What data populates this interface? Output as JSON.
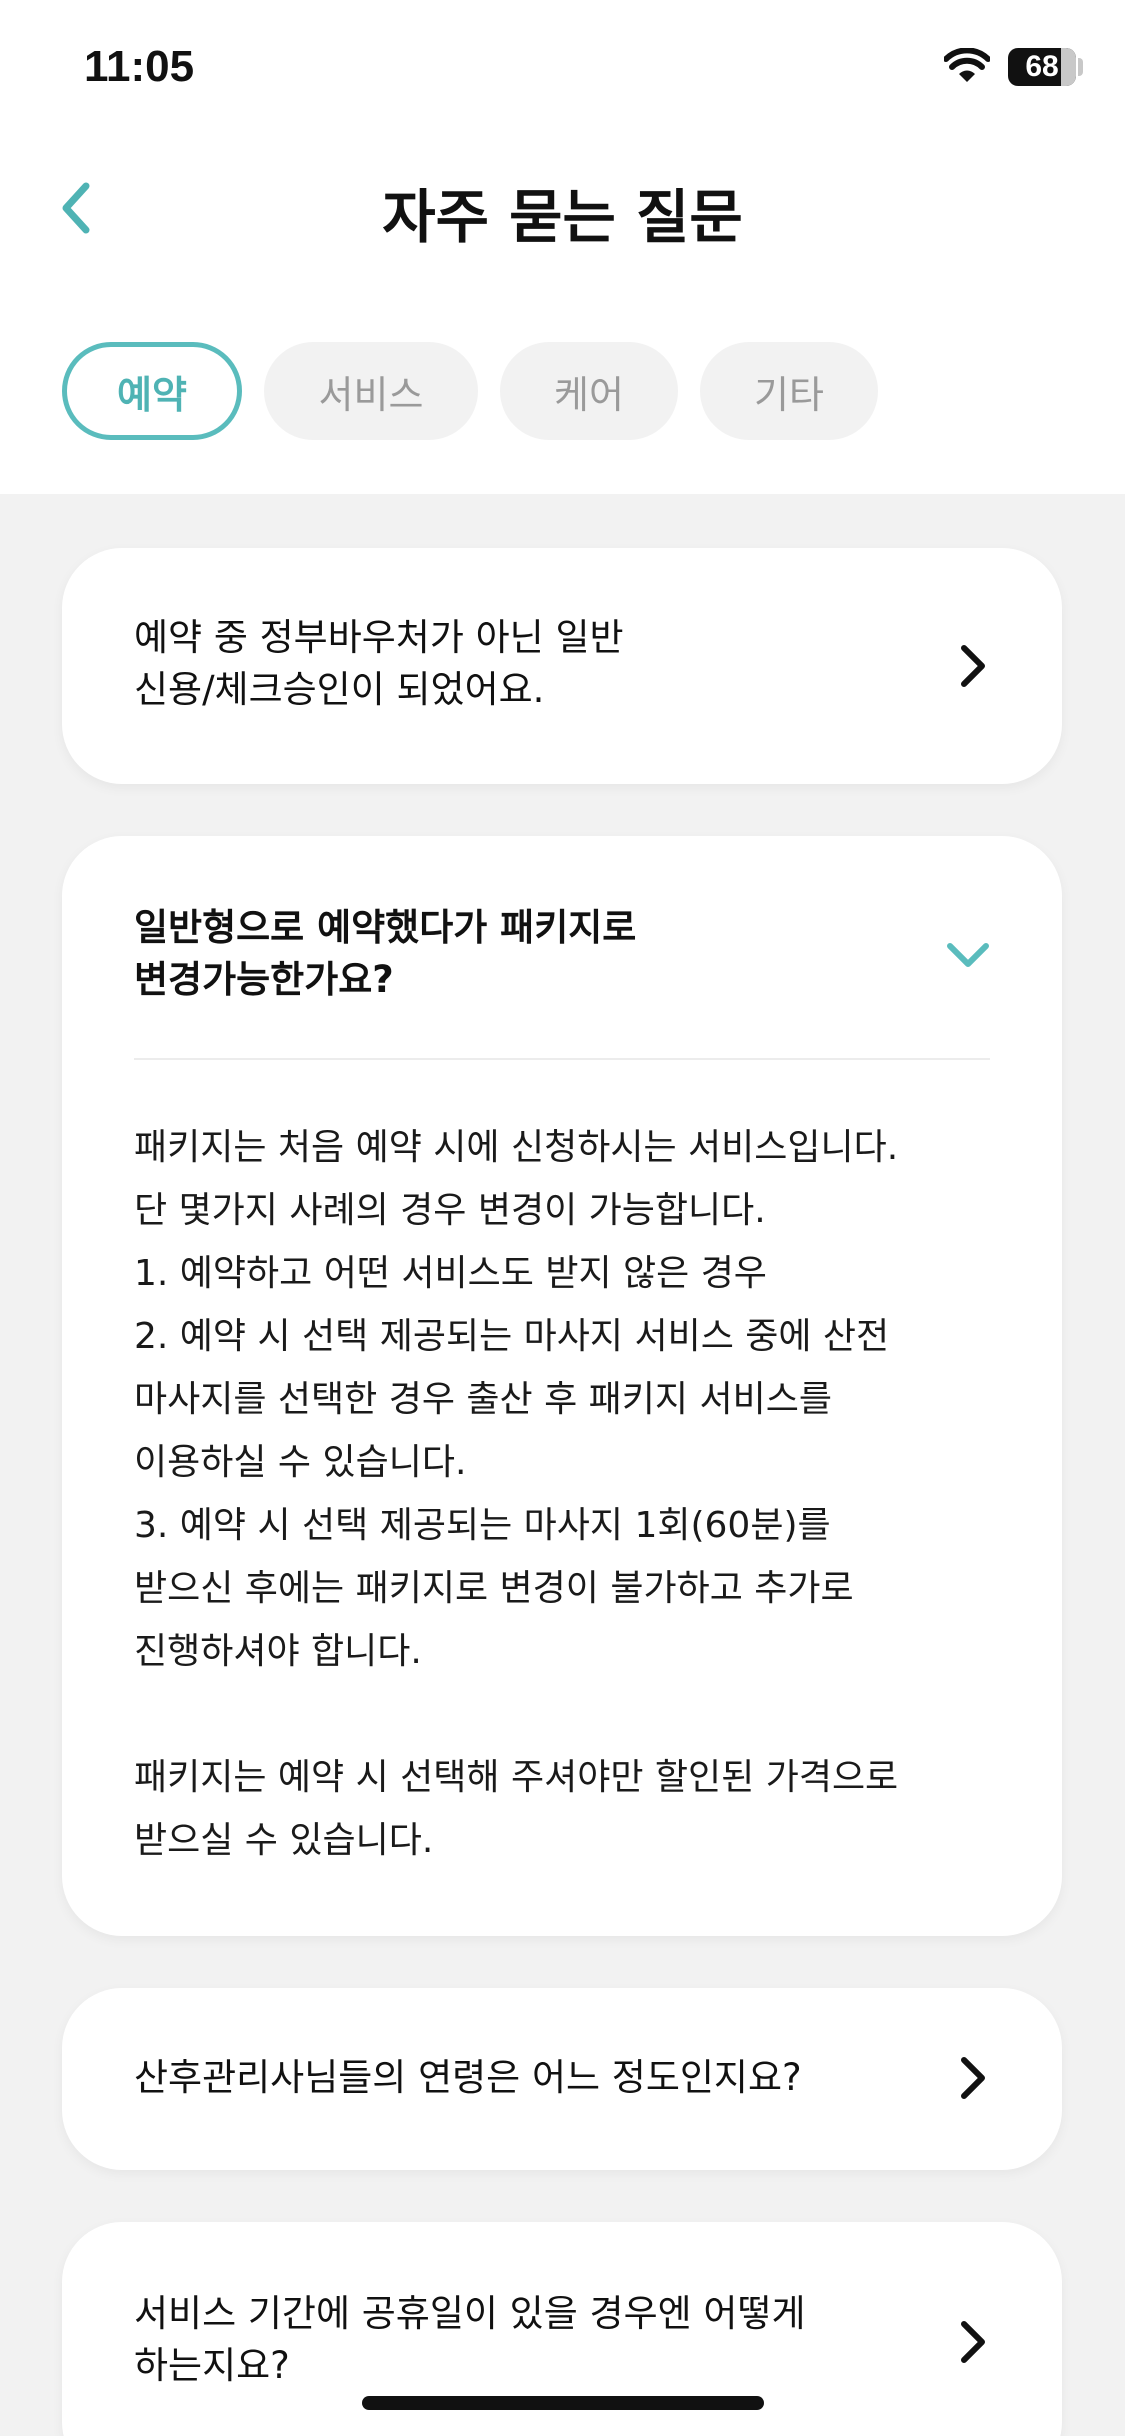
{
  "status_bar": {
    "time": "11:05",
    "battery": "68"
  },
  "header": {
    "title": "자주 묻는 질문"
  },
  "tabs": [
    {
      "label": "예약",
      "active": true
    },
    {
      "label": "서비스",
      "active": false
    },
    {
      "label": "케어",
      "active": false
    },
    {
      "label": "기타",
      "active": false
    }
  ],
  "faq": [
    {
      "question": "예약 중 정부바우처가 아닌 일반\n신용/체크승인이 되었어요.",
      "expanded": false
    },
    {
      "question": "일반형으로 예약했다가 패키지로\n변경가능한가요?",
      "expanded": true,
      "answer": "패키지는 처음 예약 시에 신청하시는 서비스입니다.\n단 몇가지 사례의 경우 변경이 가능합니다.\n1. 예약하고 어떤 서비스도 받지 않은 경우\n2. 예약 시 선택 제공되는 마사지 서비스 중에 산전\n마사지를 선택한 경우 출산 후 패키지 서비스를\n이용하실 수 있습니다.\n3. 예약 시 선택 제공되는 마사지 1회(60분)를\n받으신 후에는 패키지로 변경이 불가하고 추가로\n진행하셔야 합니다.\n\n패키지는 예약 시 선택해 주셔야만 할인된 가격으로\n받으실 수 있습니다."
    },
    {
      "question": "산후관리사님들의 연령은 어느 정도인지요?",
      "expanded": false
    },
    {
      "question": "서비스 기간에 공휴일이 있을 경우엔 어떻게\n하는지요?",
      "expanded": false
    }
  ],
  "colors": {
    "accent": "#5abcbd",
    "background": "#f2f2f2",
    "card": "#ffffff"
  },
  "icons": {
    "back": "chevron-left-icon",
    "collapsed": "chevron-right-icon",
    "expanded": "chevron-down-icon"
  }
}
